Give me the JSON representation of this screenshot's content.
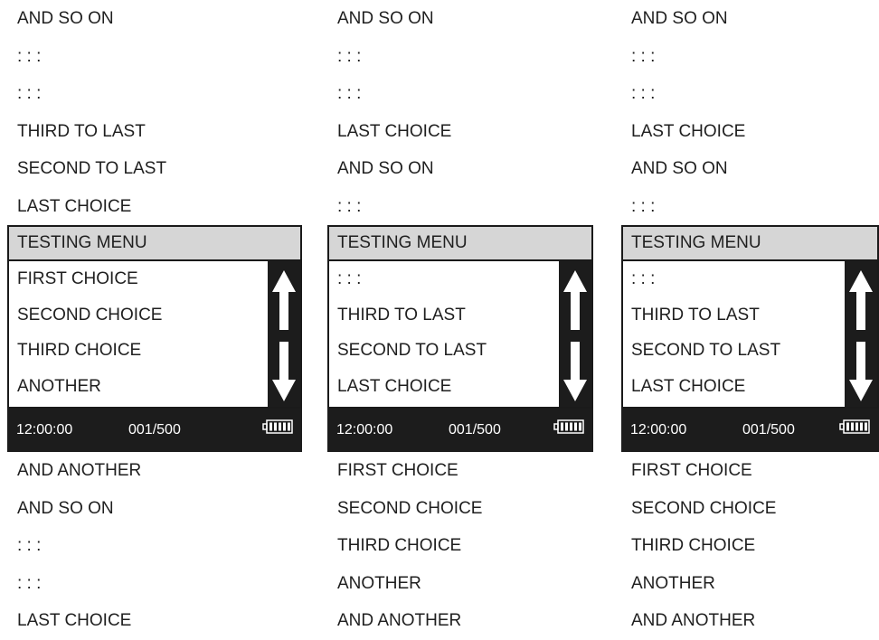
{
  "panels": [
    {
      "above": [
        "AND SO ON",
        ":   :      :",
        ":   :      :",
        "THIRD TO LAST",
        "SECOND TO LAST",
        "LAST CHOICE"
      ],
      "menu_title": "TESTING MENU",
      "visible_items": [
        "FIRST CHOICE",
        "SECOND CHOICE",
        "THIRD CHOICE",
        "ANOTHER"
      ],
      "status": {
        "time": "12:00:00",
        "counter": "001/500"
      },
      "below": [
        "AND ANOTHER",
        "AND SO ON",
        ":   :      :",
        ":   :      :",
        "LAST CHOICE"
      ]
    },
    {
      "above": [
        "AND SO ON",
        ":   :      :",
        ":   :      :",
        "LAST CHOICE",
        "AND SO ON",
        ":   :      :"
      ],
      "menu_title": "TESTING MENU",
      "visible_items": [
        ":   :      :",
        "THIRD TO LAST",
        "SECOND TO LAST",
        "LAST CHOICE"
      ],
      "status": {
        "time": "12:00:00",
        "counter": "001/500"
      },
      "below": [
        "FIRST CHOICE",
        "SECOND CHOICE",
        "THIRD CHOICE",
        "ANOTHER",
        "AND ANOTHER"
      ]
    },
    {
      "above": [
        "AND SO ON",
        ":   :      :",
        ":   :      :",
        "LAST CHOICE",
        "AND SO ON",
        ":   :      :"
      ],
      "menu_title": "TESTING MENU",
      "visible_items": [
        ":   :      :",
        "THIRD TO LAST",
        "SECOND TO LAST",
        "LAST CHOICE"
      ],
      "status": {
        "time": "12:00:00",
        "counter": "001/500"
      },
      "below": [
        "FIRST CHOICE",
        "SECOND CHOICE",
        "THIRD CHOICE",
        "ANOTHER",
        "AND ANOTHER"
      ]
    }
  ],
  "icons": {
    "scroll_up": "arrow-up-icon",
    "scroll_down": "arrow-down-icon",
    "battery": "battery-icon"
  },
  "colors": {
    "title_bar": "#d6d6d6",
    "status_bar": "#1c1c1c",
    "scrollbar": "#1c1c1c",
    "text": "#1f1f1f"
  }
}
